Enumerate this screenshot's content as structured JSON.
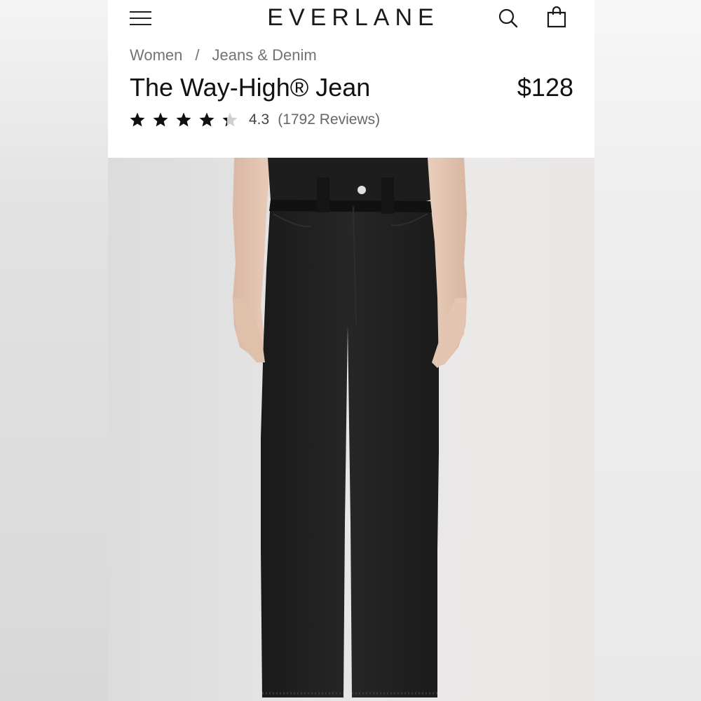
{
  "header": {
    "brand": "EVERLANE",
    "menu_icon": "hamburger-menu-icon",
    "search_icon": "search-icon",
    "cart_icon": "shopping-bag-icon"
  },
  "breadcrumb": {
    "items": [
      "Women",
      "Jeans & Denim"
    ],
    "separator": "/"
  },
  "product": {
    "title": "The Way-High® Jean",
    "price": "$128",
    "rating": {
      "value": "4.3",
      "reviews": "(1792 Reviews)",
      "stars_filled": 4.3,
      "stars_total": 5
    },
    "image": {
      "description_icon": "product-photo-black-jeans"
    }
  },
  "colors": {
    "text_primary": "#111111",
    "text_secondary": "#737373",
    "star_filled": "#111111",
    "star_empty": "#d0d0d0",
    "denim": "#1c1c1c"
  }
}
